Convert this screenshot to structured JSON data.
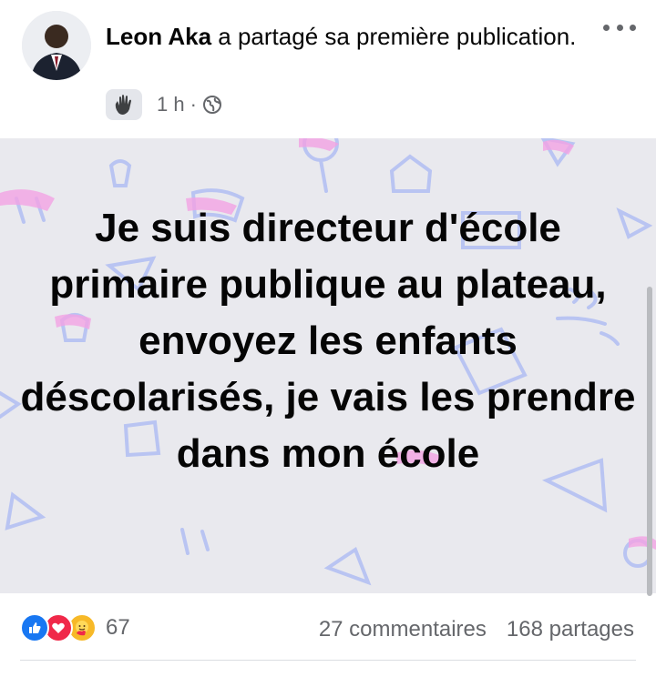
{
  "post": {
    "author": "Leon Aka",
    "action": " a partagé sa première publication.",
    "time": "1 h",
    "separator": "·",
    "text": "Je suis directeur d'école primaire publique au plateau, envoyez les enfants déscolarisés, je vais les prendre dans mon école"
  },
  "icons": {
    "badge": "waving-hand-icon",
    "audience": "globe-icon",
    "more": "more-options-icon"
  },
  "footer": {
    "reaction_count": "67",
    "comments": "27 commentaires",
    "shares": "168 partages"
  },
  "colors": {
    "background": "#e9e9ee",
    "like": "#1877f2",
    "love": "#f02849",
    "care": "#f7b928",
    "secondary_text": "#65676b"
  }
}
